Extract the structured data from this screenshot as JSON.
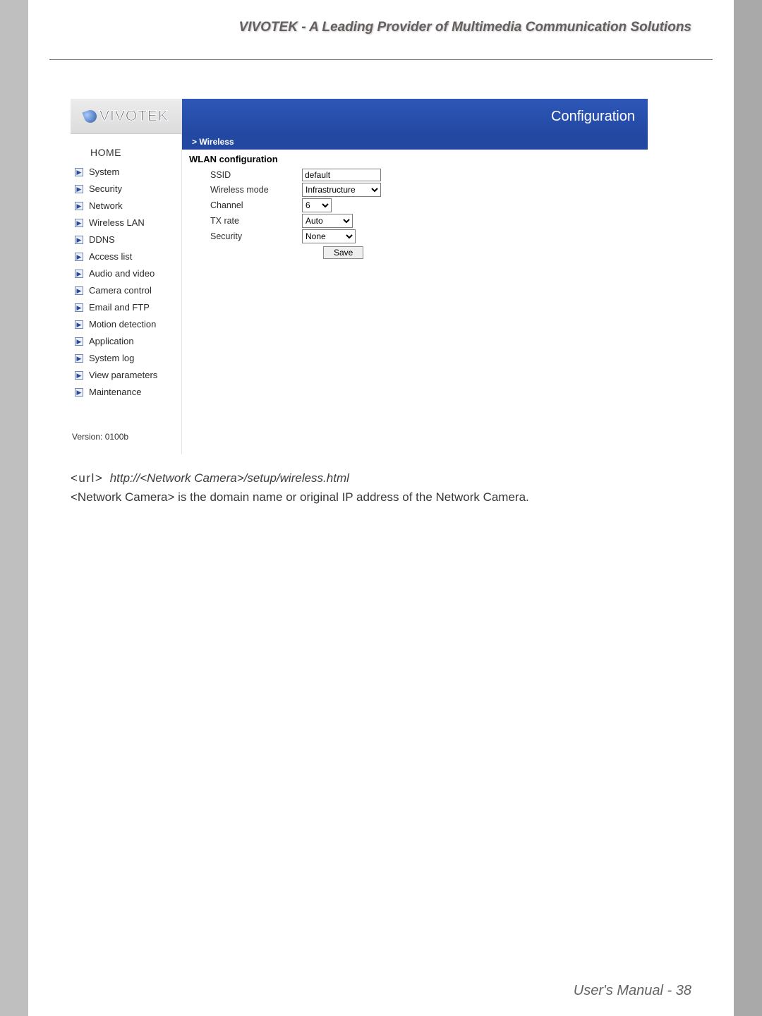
{
  "header": {
    "tagline": "VIVOTEK - A Leading Provider of Multimedia Communication Solutions"
  },
  "footer": {
    "text": "User's Manual - 38"
  },
  "app": {
    "logo": "VIVOTEK",
    "title": "Configuration",
    "section": "> Wireless",
    "version": "Version: 0100b"
  },
  "sidebar": {
    "home": "HOME",
    "items": [
      {
        "label": "System"
      },
      {
        "label": "Security"
      },
      {
        "label": "Network"
      },
      {
        "label": "Wireless LAN"
      },
      {
        "label": "DDNS"
      },
      {
        "label": "Access list"
      },
      {
        "label": "Audio and video"
      },
      {
        "label": "Camera control"
      },
      {
        "label": "Email and FTP"
      },
      {
        "label": "Motion detection"
      },
      {
        "label": "Application"
      },
      {
        "label": "System log"
      },
      {
        "label": "View parameters"
      },
      {
        "label": "Maintenance"
      }
    ]
  },
  "form": {
    "heading": "WLAN configuration",
    "ssid": {
      "label": "SSID",
      "value": "default"
    },
    "wmode": {
      "label": "Wireless mode",
      "value": "Infrastructure"
    },
    "channel": {
      "label": "Channel",
      "value": "6"
    },
    "txrate": {
      "label": "TX rate",
      "value": "Auto"
    },
    "security": {
      "label": "Security",
      "value": "None"
    },
    "save": "Save"
  },
  "caption": {
    "url_label": "<url>",
    "url_value": "http://<Network Camera>/setup/wireless.html",
    "desc": "<Network Camera> is the domain name or original IP address of the Network Camera."
  }
}
